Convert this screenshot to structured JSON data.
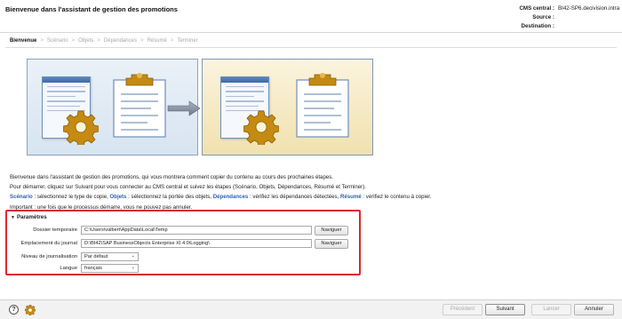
{
  "header": {
    "title": "Bienvenue dans l'assistant de gestion des promotions",
    "cms_central_label": "CMS central :",
    "cms_central_value": "BI42-SP6.decivision.intra",
    "source_label": "Source :",
    "source_value": "",
    "destination_label": "Destination :",
    "destination_value": ""
  },
  "steps": [
    {
      "label": "Bienvenue",
      "active": true
    },
    {
      "label": "Scénario",
      "active": false
    },
    {
      "label": "Objets",
      "active": false
    },
    {
      "label": "Dépendances",
      "active": false
    },
    {
      "label": "Résumé",
      "active": false
    },
    {
      "label": "Terminer",
      "active": false
    }
  ],
  "steps_separator": ">",
  "intro": {
    "line1": "Bienvenue dans l'assistant de gestion des promotions, qui vous montrera comment copier du contenu au cours des prochaines étapes.",
    "line2": "Pour démarrer, cliquez sur Suivant pour vous connecter au CMS central et suivez les étapes (Scénario, Objets, Dépendances, Résumé et Terminer).",
    "kw_scenario": "Scénario",
    "txt_scenario": " : sélectionnez le type de copie, ",
    "kw_objets": "Objets",
    "txt_objets": " : sélectionnez la portée des objets, ",
    "kw_dependances": "Dépendances",
    "txt_dependances": " : vérifiez les dépendances détectées, ",
    "kw_resume": "Résumé",
    "txt_resume": " : vérifiez le contenu à copier.",
    "line4": "Important : une fois que le processus démarre, vous ne pouvez pas annuler."
  },
  "params": {
    "title": "Paramètres",
    "temp_label": "Dossier temporaire",
    "temp_value": "C:\\Users\\valbert\\AppData\\Local\\Temp",
    "log_label": "Emplacement du journal",
    "log_value": "D:\\BI42\\SAP BusinessObjects Enterprise XI 4.0\\Logging\\",
    "browse_label": "Naviguer",
    "level_label": "Niveau de journalisation",
    "level_value": "Par défaut",
    "lang_label": "Langue",
    "lang_value": "français"
  },
  "footer": {
    "help_symbol": "?",
    "prev_label": "Précédent",
    "next_label": "Suivant",
    "finish_label": "Lancer",
    "cancel_label": "Annuler"
  },
  "colors": {
    "accent_keyword": "#2c63b4",
    "highlight_border": "#d92a2a",
    "panel_blue": "#d7e4f1",
    "panel_yellow": "#f0e1ae"
  },
  "icons": [
    "window-icon",
    "gear-icon",
    "clipboard-icon",
    "arrow-right-icon",
    "help-icon",
    "settings-icon",
    "chevron-down-icon"
  ]
}
